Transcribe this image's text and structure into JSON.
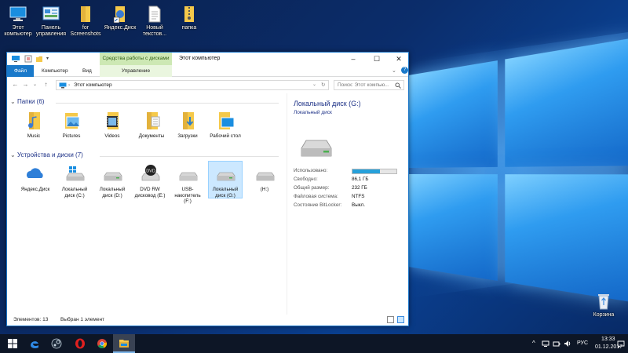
{
  "desktop": {
    "icons": [
      {
        "label": "Этот компьютер",
        "icon": "computer-icon"
      },
      {
        "label": "Панель управления",
        "icon": "control-panel-icon"
      },
      {
        "label": "for Screenshots",
        "icon": "folder-icon"
      },
      {
        "label": "Яндекс.Диск",
        "icon": "yandex-disk-shortcut-icon"
      },
      {
        "label": "Новый текстов...",
        "icon": "text-file-icon"
      },
      {
        "label": "папка",
        "icon": "zip-folder-icon"
      }
    ],
    "recycle_bin": {
      "label": "Корзина",
      "icon": "recycle-bin-icon"
    }
  },
  "window": {
    "title": "Этот компьютер",
    "context_tab": "Средства работы с дисками",
    "ribbon_tabs": {
      "file": "Файл",
      "computer": "Компьютер",
      "view": "Вид",
      "manage": "Управление"
    },
    "address": "Этот компьютер",
    "search_placeholder": "Поиск: Этот компью...",
    "groups": {
      "folders_header": "Папки (6)",
      "devices_header": "Устройства и диски (7)"
    },
    "folders": [
      {
        "label": "Music",
        "icon": "music-folder-icon"
      },
      {
        "label": "Pictures",
        "icon": "pictures-folder-icon"
      },
      {
        "label": "Videos",
        "icon": "videos-folder-icon"
      },
      {
        "label": "Документы",
        "icon": "documents-folder-icon"
      },
      {
        "label": "Загрузки",
        "icon": "downloads-folder-icon"
      },
      {
        "label": "Рабочий стол",
        "icon": "desktop-folder-icon"
      }
    ],
    "devices": [
      {
        "label": "Яндекс.Диск",
        "icon": "cloud-icon"
      },
      {
        "label": "Локальный диск (C:)",
        "icon": "system-drive-icon"
      },
      {
        "label": "Локальный диск (D:)",
        "icon": "drive-icon"
      },
      {
        "label": "DVD RW дисковод (E:)",
        "icon": "dvd-drive-icon",
        "badge": "DVD"
      },
      {
        "label": "USB-накопитель (F:)",
        "icon": "usb-drive-icon"
      },
      {
        "label": "Локальный диск (G:)",
        "icon": "drive-icon",
        "selected": true
      },
      {
        "label": "(H:)",
        "icon": "drive-icon"
      }
    ],
    "details": {
      "title": "Локальный диск (G:)",
      "subtitle": "Локальный диск",
      "used_label": "Использовано:",
      "used_fraction": 0.63,
      "free_label": "Свободно:",
      "free_value": "86,1 ГБ",
      "total_label": "Общий размер:",
      "total_value": "232 ГБ",
      "fs_label": "Файловая система:",
      "fs_value": "NTFS",
      "bitlocker_label": "Состояние BitLocker:",
      "bitlocker_value": "Выкл."
    },
    "status": {
      "count": "Элементов: 13",
      "selected": "Выбран 1 элемент"
    }
  },
  "taskbar": {
    "language": "РУС",
    "time": "13:33",
    "date": "01.12.2017"
  },
  "colors": {
    "accent": "#1979ca",
    "selection": "#cce8ff",
    "header": "#1e3287",
    "context_tab": "#cde8b4"
  }
}
